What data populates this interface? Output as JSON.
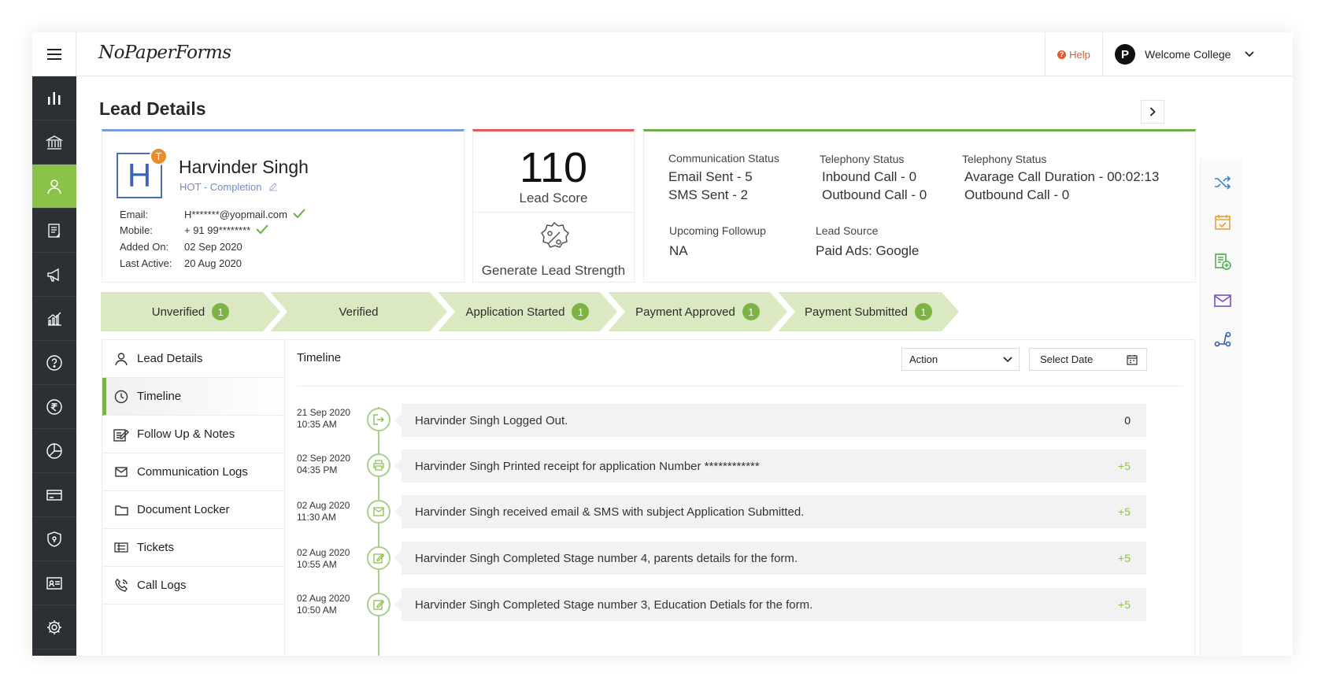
{
  "header": {
    "logo_text": "NoPaperForms",
    "help_label": "Help",
    "avatar_initial": "P",
    "welcome_text": "Welcome College"
  },
  "nav": {
    "items": [
      "menu-icon",
      "analytics-icon",
      "institution-icon",
      "user-icon",
      "form-icon",
      "campaign-icon",
      "reports-icon",
      "help-icon",
      "rupee-icon",
      "pie-chart-icon",
      "card-icon",
      "shield-icon",
      "id-card-icon",
      "settings-icon"
    ],
    "active_item": "user-icon"
  },
  "page": {
    "title": "Lead Details"
  },
  "profile": {
    "initial": "H",
    "badge": "T",
    "name": "Harvinder Singh",
    "tag": "HOT - Completion",
    "email_label": "Email:",
    "email": "H*******@yopmail.com",
    "mobile_label": "Mobile:",
    "mobile": "+ 91 99********",
    "added_label": "Added On:",
    "added": "02 Sep 2020",
    "active_label": "Last Active:",
    "active": "20 Aug 2020"
  },
  "score": {
    "value": "110",
    "label": "Lead Score",
    "generate_label": "Generate Lead Strength"
  },
  "status": {
    "comm_label": "Communication Status",
    "email_sent": "Email Sent - 5",
    "sms_sent": "SMS Sent - 2",
    "tel1_label": "Telephony Status",
    "inbound": "Inbound Call - 0",
    "outbound1": "Outbound Call - 0",
    "tel2_label": "Telephony Status",
    "avg_duration": "Avarage Call Duration - 00:02:13",
    "outbound2": "Outbound Call - 0",
    "followup_label": "Upcoming Followup",
    "followup": "NA",
    "source_label": "Lead Source",
    "source": "Paid Ads: Google"
  },
  "stages": [
    {
      "label": "Unverified",
      "count": "1"
    },
    {
      "label": "Verified",
      "count": ""
    },
    {
      "label": "Application Started",
      "count": "1"
    },
    {
      "label": "Payment Approved",
      "count": "1"
    },
    {
      "label": "Payment Submitted",
      "count": "1"
    }
  ],
  "tabs": [
    {
      "label": "Lead Details",
      "icon": "user-icon"
    },
    {
      "label": "Timeline",
      "icon": "clock-icon"
    },
    {
      "label": "Follow Up & Notes",
      "icon": "edit-note-icon"
    },
    {
      "label": "Communication Logs",
      "icon": "mail-icon"
    },
    {
      "label": "Document Locker",
      "icon": "folder-icon"
    },
    {
      "label": "Tickets",
      "icon": "ticket-icon"
    },
    {
      "label": "Call Logs",
      "icon": "phone-icon"
    }
  ],
  "active_tab": "Timeline",
  "timeline": {
    "title": "Timeline",
    "action_label": "Action",
    "date_label": "Select Date",
    "entries": [
      {
        "date": "21 Sep 2020",
        "time": "10:35 AM",
        "icon": "logout-icon",
        "text": "Harvinder Singh Logged Out.",
        "points": "0"
      },
      {
        "date": "02 Sep 2020",
        "time": "04:35 PM",
        "icon": "print-icon",
        "text": "Harvinder Singh Printed receipt for application Number ************",
        "points": "+5"
      },
      {
        "date": "02 Aug 2020",
        "time": "11:30 AM",
        "icon": "mail-icon",
        "text": "Harvinder Singh received email & SMS with subject Application Submitted.",
        "points": "+5"
      },
      {
        "date": "02 Aug 2020",
        "time": "10:55 AM",
        "icon": "edit-icon",
        "text": "Harvinder Singh Completed Stage number 4, parents details for the form.",
        "points": "+5"
      },
      {
        "date": "02 Aug 2020",
        "time": "10:50 AM",
        "icon": "edit-icon",
        "text": "Harvinder Singh Completed Stage number 3, Education Detials for the form.",
        "points": "+5"
      }
    ]
  },
  "rail": {
    "icons": [
      "shuffle-icon",
      "calendar-icon",
      "add-note-icon",
      "mail-icon",
      "route-icon"
    ],
    "colors": [
      "#3f7fd6",
      "#e8a13a",
      "#4caf50",
      "#7a4fc4",
      "#2f5fae"
    ]
  },
  "colors": {
    "accent_green": "#8bc34a",
    "nav_dark": "#2c2f33",
    "stage_bg": "#dbe9c3",
    "help_orange": "#e05a2b"
  }
}
